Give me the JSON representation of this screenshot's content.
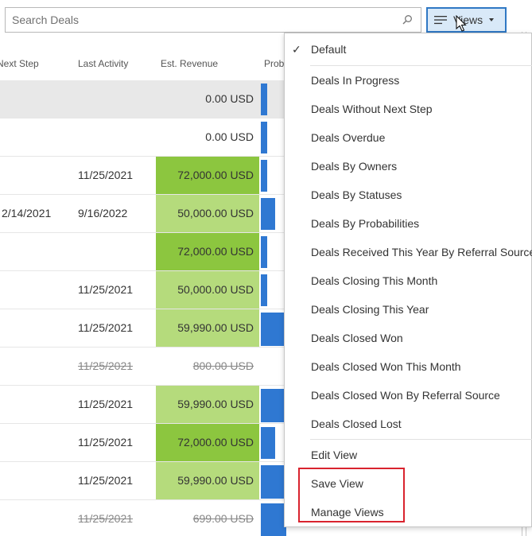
{
  "search": {
    "placeholder": "Search Deals",
    "icon": "search-icon"
  },
  "views_button": {
    "label": "Views",
    "icon": "hamburger-icon"
  },
  "grid": {
    "columns": {
      "next_step": "Next Step",
      "last_activity": "Last Activity",
      "est_revenue": "Est. Revenue",
      "probability": "Prob"
    },
    "rows": [
      {
        "next_step": "",
        "last_activity": "",
        "revenue": "0.00 USD"
      },
      {
        "next_step": "",
        "last_activity": "",
        "revenue": "0.00 USD"
      },
      {
        "next_step": "",
        "last_activity": "11/25/2021",
        "revenue": "72,000.00 USD"
      },
      {
        "next_step": "2/14/2021",
        "last_activity": "9/16/2022",
        "revenue": "50,000.00 USD"
      },
      {
        "next_step": "",
        "last_activity": "",
        "revenue": "72,000.00 USD"
      },
      {
        "next_step": "",
        "last_activity": "11/25/2021",
        "revenue": "50,000.00 USD"
      },
      {
        "next_step": "",
        "last_activity": "11/25/2021",
        "revenue": "59,990.00 USD"
      },
      {
        "next_step": "",
        "last_activity": "11/25/2021",
        "revenue": "800.00 USD"
      },
      {
        "next_step": "",
        "last_activity": "11/25/2021",
        "revenue": "59,990.00 USD"
      },
      {
        "next_step": "",
        "last_activity": "11/25/2021",
        "revenue": "72,000.00 USD"
      },
      {
        "next_step": "",
        "last_activity": "11/25/2021",
        "revenue": "59,990.00 USD"
      },
      {
        "next_step": "",
        "last_activity": "11/25/2021",
        "revenue": "699.00 USD"
      }
    ]
  },
  "menu": {
    "default": "Default",
    "views": [
      "Deals In Progress",
      "Deals Without Next Step",
      "Deals Overdue",
      "Deals By Owners",
      "Deals By Statuses",
      "Deals By Probabilities",
      "Deals Received This Year By Referral Sources",
      "Deals Closing This Month",
      "Deals Closing This Year",
      "Deals Closed Won",
      "Deals Closed Won This Month",
      "Deals Closed Won By Referral Source",
      "Deals Closed Lost"
    ],
    "actions": [
      "Edit View",
      "Save View",
      "Manage Views"
    ]
  },
  "colors": {
    "accent": "#2f78c4",
    "revenue_dark": "#8cc63f",
    "revenue_light": "#b5db7c",
    "probability_bar": "#2f78d2",
    "highlight": "#d9232e"
  }
}
